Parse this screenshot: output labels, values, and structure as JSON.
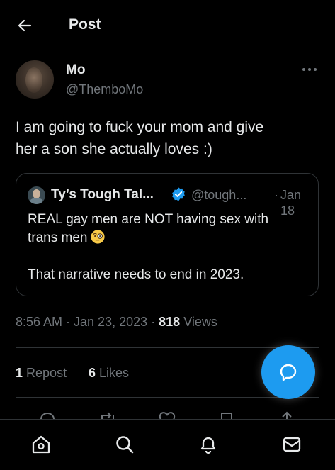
{
  "header": {
    "title": "Post"
  },
  "author": {
    "name": "Mo",
    "handle": "@ThemboMo"
  },
  "tweet": {
    "text": "I am going to fuck your mom and give\nher a son she actually loves :)"
  },
  "quote": {
    "name": "Ty’s Tough Tal...",
    "handle": "@tough...",
    "dot": "·",
    "date": "Jan 18",
    "line1": "REAL gay men are NOT having sex with",
    "line2": "trans men",
    "line3": "That narrative needs to end in 2023.",
    "emoji": "face-with-monocle"
  },
  "meta": {
    "time": "8:56 AM · Jan 23, 2023 ·",
    "views_count": "818",
    "views_label": "Views"
  },
  "stats": {
    "reposts_count": "1",
    "reposts_label": "Repost",
    "likes_count": "6",
    "likes_label": "Likes"
  },
  "colors": {
    "accent": "#1d9bf0",
    "background": "#000000",
    "text": "#e7e9ea",
    "secondary": "#71767b",
    "border": "#2f3336"
  },
  "icons": {
    "back": "arrow-left-icon",
    "more": "more-icon",
    "verified": "verified-badge-icon",
    "fab": "compose-reply-icon",
    "nav": [
      "home-icon",
      "search-icon",
      "notifications-icon",
      "messages-icon"
    ],
    "actions": [
      "reply-icon",
      "retweet-icon",
      "like-icon",
      "bookmark-icon",
      "share-icon"
    ]
  }
}
